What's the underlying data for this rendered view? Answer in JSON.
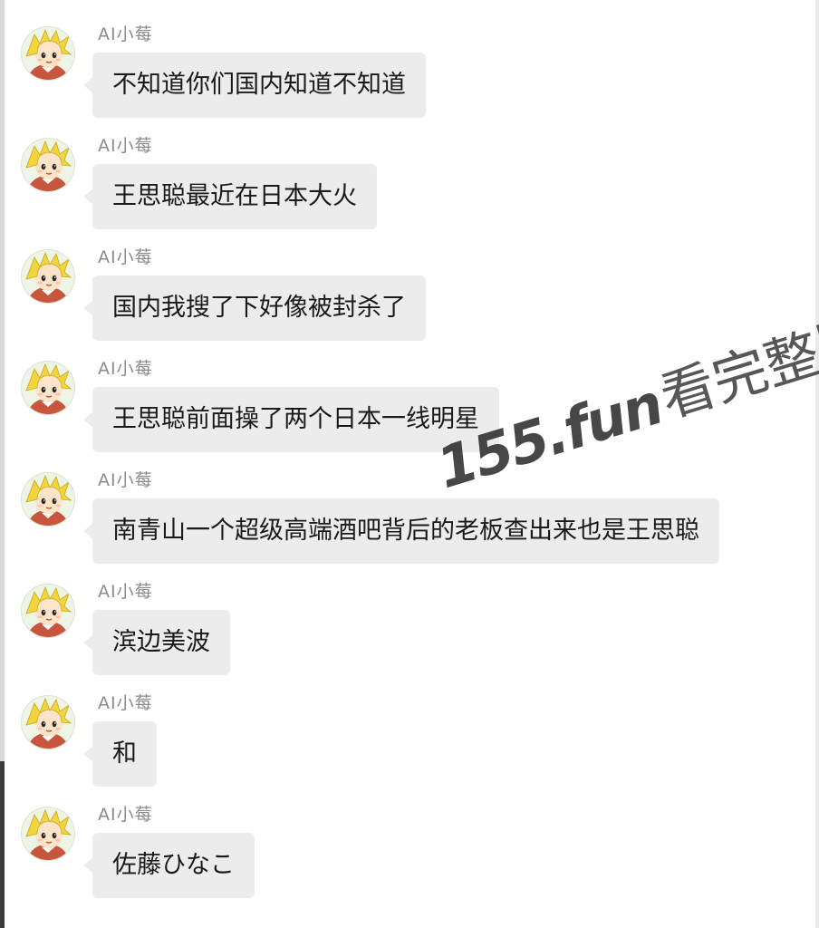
{
  "sender_name": "AI小莓",
  "messages": [
    {
      "text": "不知道你们国内知道不知道"
    },
    {
      "text": "王思聪最近在日本大火"
    },
    {
      "text": "国内我搜了下好像被封杀了"
    },
    {
      "text": "王思聪前面操了两个日本一线明星"
    },
    {
      "text": "南青山一个超级高端酒吧背后的老板查出来也是王思聪"
    },
    {
      "text": "滨边美波"
    },
    {
      "text": "和"
    },
    {
      "text": "佐藤ひなこ"
    }
  ],
  "watermark": {
    "number": "155.fun",
    "text": "看完整版"
  },
  "colors": {
    "bubble": "#ececec",
    "sender": "#8c8c8c",
    "avatar_hair": "#f2d53c"
  }
}
